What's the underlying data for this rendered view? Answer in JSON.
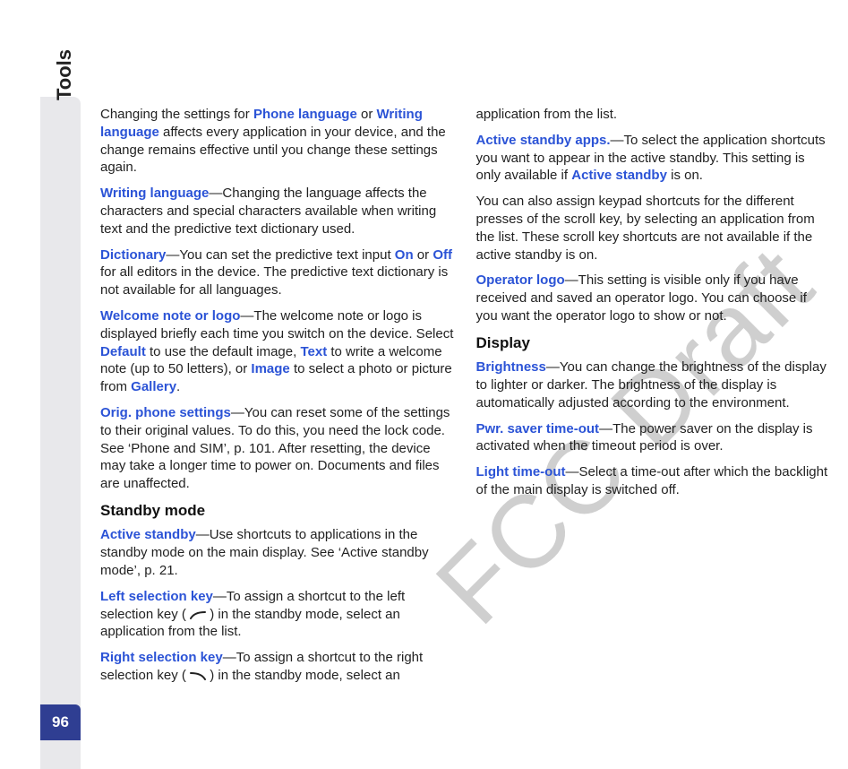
{
  "page": {
    "side_title": "Tools",
    "page_number": "96",
    "watermark": "FCC Draft"
  },
  "terms": {
    "phone_language": "Phone language",
    "writing_language": "Writing language",
    "writing_language2": "Writing language",
    "dictionary": "Dictionary",
    "on": "On",
    "off": "Off",
    "welcome": "Welcome note or logo",
    "default": "Default",
    "text": "Text",
    "image": "Image",
    "gallery": "Gallery",
    "orig": "Orig. phone settings",
    "active_standby": "Active standby",
    "left_sel": "Left selection key",
    "right_sel": "Right selection key",
    "asa": "Active standby apps.",
    "active_standby2": "Active standby",
    "op_logo": "Operator logo",
    "brightness": "Brightness",
    "pwr": "Pwr. saver time-out",
    "light": "Light time-out"
  },
  "headings": {
    "standby": "Standby mode",
    "display": "Display"
  },
  "body": {
    "p1a": "Changing the settings for ",
    "p1b": " or ",
    "p1c": " affects every application in your device, and the change remains effective until you change these settings again.",
    "p2a": "—Changing the language affects the characters and special characters available when writing text and the predictive text dictionary used.",
    "p3a": "—You can set the predictive text input ",
    "p3b": " or ",
    "p3c": " for all editors in the device. The predictive text dictionary is not available for all languages.",
    "p4a": "—The welcome note or logo is displayed briefly each time you switch on the device. Select ",
    "p4b": " to use the default image, ",
    "p4c": " to write a welcome note (up to 50 letters), or ",
    "p4d": " to select a photo or picture from ",
    "p4e": ".",
    "p5a": "—You can reset some of the settings to their original values. To do this, you need the lock code. See ‘Phone and SIM’, p. 101. After resetting, the device may take a longer time to power on. Documents and files are unaffected.",
    "p6a": "—Use shortcuts to applications in the standby mode on the main display. See ‘Active standby mode’, p. 21.",
    "p7a": "—To assign a shortcut to the left selection key ( ",
    "p7b": " ) in the standby mode, select an application from the list.",
    "p8a": "—To assign a shortcut to the right selection key ( ",
    "p8b": " ) in the standby mode, select an application from the list.",
    "p9a": "—To select the application shortcuts you want to appear in the active standby. This setting is only available if ",
    "p9b": " is on.",
    "p10": "You can also assign keypad shortcuts for the different presses of the scroll key, by selecting an application from the list. These scroll key shortcuts are not available if the active standby is on.",
    "p11a": "—This setting is visible only if you have received and saved an operator logo. You can choose if you want the operator logo to show or not.",
    "p12a": "—You can change the brightness of the display to lighter or darker. The brightness of the display is automatically adjusted according to the environment.",
    "p13a": "—The power saver on the display is activated when the timeout period is over.",
    "p14a": "—Select a time-out after which the backlight of the main display is switched off."
  }
}
